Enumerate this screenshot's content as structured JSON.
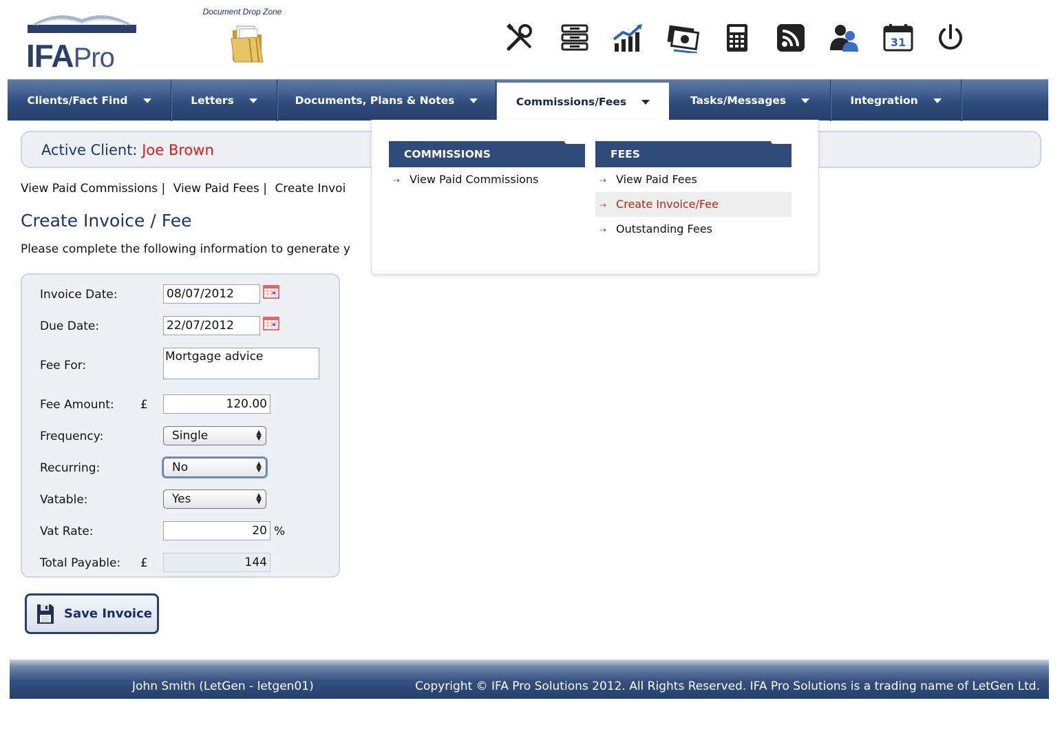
{
  "app": {
    "logo_text_bold": "IFA",
    "logo_text_light": "Pro",
    "drop_zone_label": "Document Drop Zone"
  },
  "toolbar": {
    "icons": [
      "tools-icon",
      "filing-icon",
      "chart-icon",
      "money-icon",
      "calculator-icon",
      "rss-icon",
      "users-icon",
      "calendar-icon",
      "power-icon"
    ],
    "calendar_day": "31"
  },
  "nav": {
    "items": [
      {
        "label": "Clients/Fact Find"
      },
      {
        "label": "Letters"
      },
      {
        "label": "Documents, Plans & Notes"
      },
      {
        "label": "Commissions/Fees",
        "active": true
      },
      {
        "label": "Tasks/Messages"
      },
      {
        "label": "Integration"
      }
    ]
  },
  "active_client": {
    "label": "Active Client:",
    "name": "Joe Brown"
  },
  "sublinks": {
    "paid_commissions": "View Paid Commissions |",
    "paid_fees": "View Paid Fees |",
    "create_invoice": "Create Invoi"
  },
  "page": {
    "title": "Create Invoice / Fee",
    "intro": "Please complete the following information to generate y"
  },
  "form": {
    "invoice_date_label": "Invoice Date:",
    "invoice_date": "08/07/2012",
    "due_date_label": "Due Date:",
    "due_date": "22/07/2012",
    "fee_for_label": "Fee For:",
    "fee_for": "Mortgage advice",
    "fee_amount_label": "Fee Amount:",
    "currency": "£",
    "fee_amount": "120.00",
    "frequency_label": "Frequency:",
    "frequency": "Single",
    "recurring_label": "Recurring:",
    "recurring": "No",
    "vatable_label": "Vatable:",
    "vatable": "Yes",
    "vat_rate_label": "Vat Rate:",
    "vat_rate": "20",
    "percent": "%",
    "total_label": "Total Payable:",
    "total": "144"
  },
  "save_button": {
    "label": "Save Invoice"
  },
  "dropdown": {
    "commissions_header": "COMMISSIONS",
    "commissions_items": [
      "View Paid Commissions"
    ],
    "fees_header": "FEES",
    "fees_items": [
      "View Paid Fees",
      "Create Invoice/Fee",
      "Outstanding Fees"
    ],
    "arrow_glyph": "⇢"
  },
  "footer": {
    "user": "John Smith (LetGen - letgen01)",
    "copyright": "Copyright © IFA Pro Solutions 2012. All Rights Reserved. IFA Pro Solutions is a trading name of LetGen Ltd."
  },
  "colors": {
    "brand_navy": "#2b3f6b",
    "nav_blue": "#2d4a78",
    "client_name_red": "#e01b1b",
    "active_menu_red": "#b72a10"
  }
}
